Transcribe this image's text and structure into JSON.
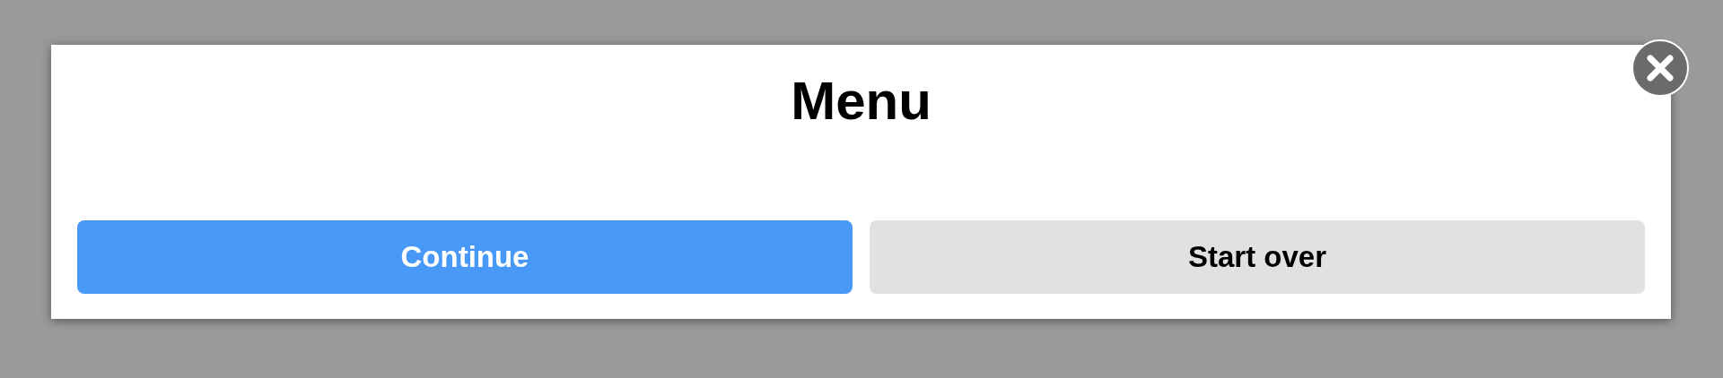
{
  "dialog": {
    "title": "Menu",
    "buttons": [
      {
        "label": "Continue",
        "kind": "primary"
      },
      {
        "label": "Start over",
        "kind": "secondary"
      }
    ]
  }
}
